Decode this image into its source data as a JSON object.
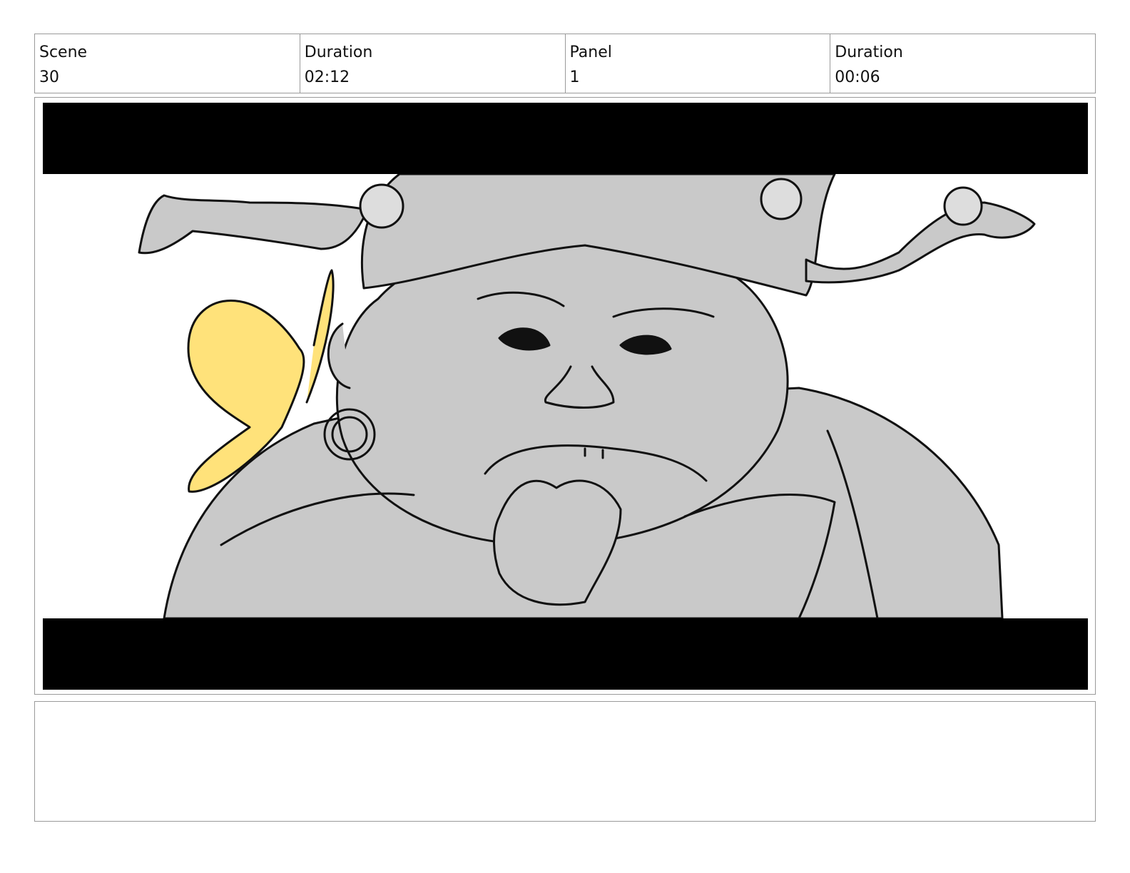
{
  "header": {
    "scene": {
      "label": "Scene",
      "value": "30"
    },
    "scene_duration": {
      "label": "Duration",
      "value": "02:12"
    },
    "panel": {
      "label": "Panel",
      "value": "1"
    },
    "panel_duration": {
      "label": "Duration",
      "value": "00:06"
    }
  },
  "panel": {
    "letterbox_color": "#000000",
    "fill_gray": "#c9c9c9",
    "wing_yellow": "#ffe27a"
  },
  "notes": {
    "text": ""
  }
}
